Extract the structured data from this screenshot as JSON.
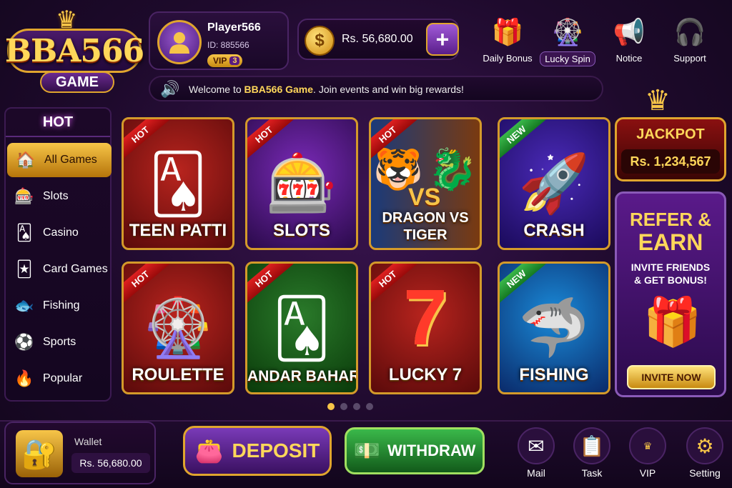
{
  "brand": {
    "logo_text": "BBA566",
    "logo_sub": "GAME"
  },
  "player": {
    "name": "Player566",
    "id": "ID: 885566",
    "vip_label": "VIP",
    "vip_level": "3"
  },
  "balance": {
    "amount": "Rs. 56,680.00",
    "coin_glyph": "$",
    "add_glyph": "+"
  },
  "top_actions": [
    {
      "label": "Daily Bonus",
      "icon": "gift-icon"
    },
    {
      "label": "Lucky Spin",
      "icon": "wheel-icon"
    },
    {
      "label": "Notice",
      "icon": "megaphone-icon"
    },
    {
      "label": "Support",
      "icon": "headset-icon"
    }
  ],
  "marquee": {
    "prefix": "Welcome to ",
    "highlight": "BBA566 Game",
    "suffix": ". Join events and win big rewards!"
  },
  "sidebar": {
    "header": "HOT",
    "items": [
      {
        "label": "All Games",
        "icon": "home-icon",
        "active": true
      },
      {
        "label": "Slots",
        "icon": "slots-icon"
      },
      {
        "label": "Casino",
        "icon": "cards-icon"
      },
      {
        "label": "Card Games",
        "icon": "playing-cards-icon"
      },
      {
        "label": "Fishing",
        "icon": "fish-icon"
      },
      {
        "label": "Sports",
        "icon": "soccer-ball-icon"
      },
      {
        "label": "Popular",
        "icon": "fire-icon"
      }
    ]
  },
  "games": [
    {
      "title": "TEEN PATTI",
      "badge": "HOT",
      "theme": "red"
    },
    {
      "title": "SLOTS",
      "badge": "HOT",
      "theme": "purple"
    },
    {
      "title": "DRAGON VS TIGER",
      "badge": "HOT",
      "theme": "vs",
      "vs_text": "VS"
    },
    {
      "title": "CRASH",
      "badge": "NEW",
      "theme": "blue"
    },
    {
      "title": "ROULETTE",
      "badge": "HOT",
      "theme": "red"
    },
    {
      "title": "ANDAR BAHAR",
      "badge": "HOT",
      "theme": "green"
    },
    {
      "title": "LUCKY 7",
      "badge": "HOT",
      "theme": "red"
    },
    {
      "title": "FISHING",
      "badge": "NEW",
      "theme": "ocean"
    }
  ],
  "carousel": {
    "pages": 4,
    "current": 1
  },
  "jackpot": {
    "title": "JACKPOT",
    "amount": "Rs. 1,234,567"
  },
  "refer": {
    "line1": "REFER &",
    "line2": "EARN",
    "sub1": "INVITE FRIENDS",
    "sub2": "& GET BONUS!",
    "button": "INVITE NOW"
  },
  "wallet": {
    "label": "Wallet",
    "amount": "Rs. 56,680.00"
  },
  "deposit": {
    "label": "DEPOSIT"
  },
  "withdraw": {
    "label": "WITHDRAW"
  },
  "bottom_nav": [
    {
      "label": "Mail",
      "icon": "mail-icon"
    },
    {
      "label": "Task",
      "icon": "clipboard-icon"
    },
    {
      "label": "VIP",
      "icon": "vip-crown-icon"
    },
    {
      "label": "Setting",
      "icon": "gear-icon"
    }
  ],
  "colors": {
    "gold": "#f7c548",
    "purple": "#3a1450",
    "hot": "#e02020",
    "new": "#3ab84a"
  }
}
